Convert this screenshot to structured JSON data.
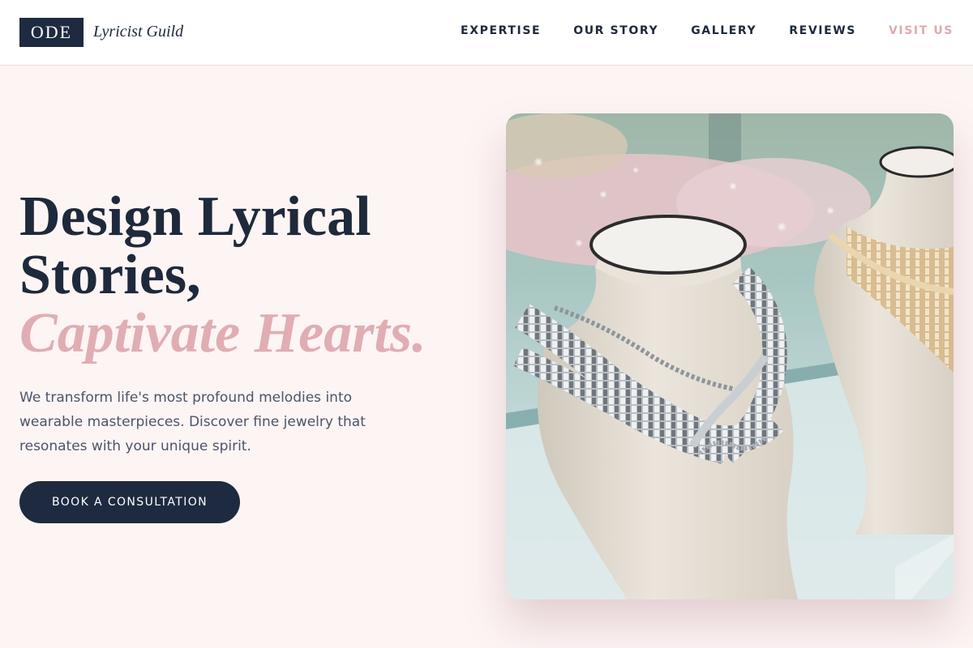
{
  "brand": {
    "logo_text": "ODE",
    "name": "Lyricist Guild"
  },
  "nav": {
    "items": [
      {
        "label": "EXPERTISE",
        "accent": false
      },
      {
        "label": "OUR STORY",
        "accent": false
      },
      {
        "label": "GALLERY",
        "accent": false
      },
      {
        "label": "REVIEWS",
        "accent": false
      },
      {
        "label": "VISIT US",
        "accent": true
      }
    ]
  },
  "hero": {
    "title_line1": "Design Lyrical",
    "title_line2": "Stories,",
    "title_accent": "Captivate Hearts.",
    "description": "We transform life's most profound melodies into wearable masterpieces. Discover fine jewelry that resonates with your unique spirit.",
    "cta_label": "BOOK A CONSULTATION"
  },
  "colors": {
    "navy": "#1e2a3f",
    "rose_accent": "#e0adb3",
    "background": "#fdf4f4"
  }
}
